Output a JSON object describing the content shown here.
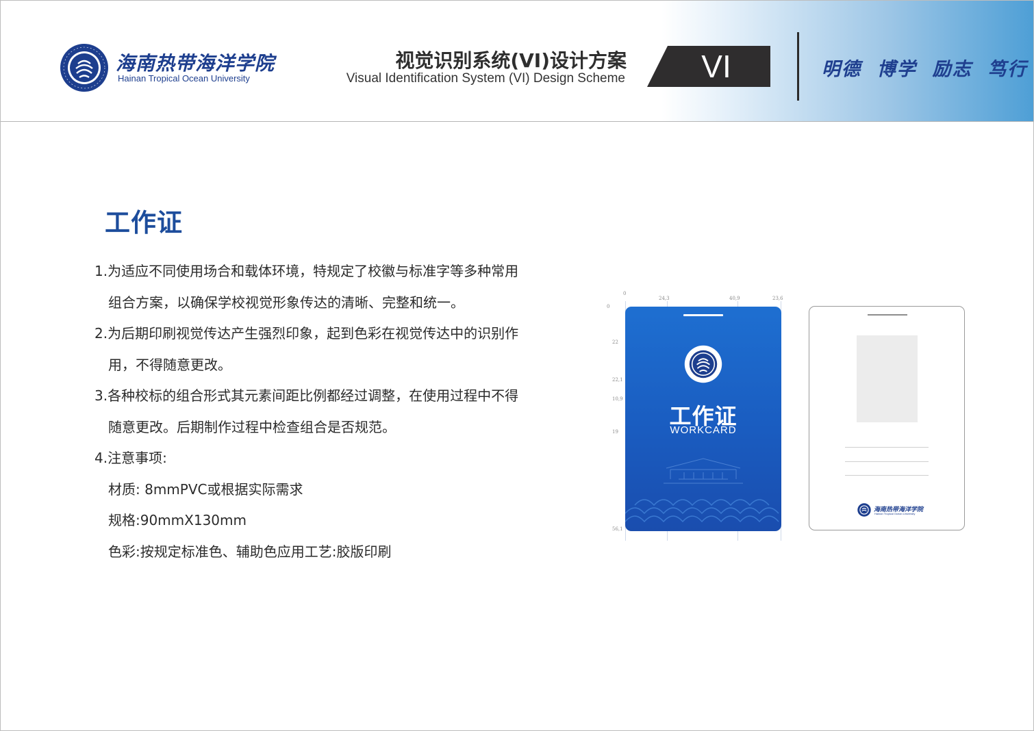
{
  "header": {
    "university_cn": "海南热带海洋学院",
    "university_en": "Hainan Tropical Ocean University",
    "title_cn": "视觉识别系统(VI)设计方案",
    "title_en": "Visual Identification System (VI) Design Scheme",
    "badge": "VI",
    "motto": "明德  博学  励志  笃行"
  },
  "section": {
    "title": "工作证",
    "lines": [
      "1.为适应不同使用场合和载体环境，特规定了校徽与标准字等多种常用",
      "组合方案，以确保学校视觉形象传达的清晰、完整和统一。",
      "2.为后期印刷视觉传达产生强烈印象，起到色彩在视觉传达中的识别作",
      "用，不得随意更改。",
      "3.各种校标的组合形式其元素间距比例都经过调整，在使用过程中不得",
      "随意更改。后期制作过程中检查组合是否规范。",
      "4.注意事项:",
      "材质: 8mmPVC或根据实际需求",
      "规格:90mmX130mm",
      "色彩:按规定标准色、辅助色应用工艺:胶版印刷"
    ]
  },
  "card": {
    "front_title_cn": "工作证",
    "front_title_en": "WORKCARD",
    "back_logo_cn": "海南热带海洋学院",
    "back_logo_en": "Hainan Tropical Ocean University",
    "dimensions": {
      "top": [
        "0",
        "24,3",
        "40,9",
        "23,6"
      ],
      "left": [
        "0",
        "22",
        "22,1",
        "10,9",
        "19",
        "56,1"
      ]
    }
  },
  "colors": {
    "brand_blue": "#1d3e8e",
    "card_blue": "#1a5cc0",
    "badge_dark": "#2f2d2e",
    "title_blue": "#1d4d9c"
  }
}
